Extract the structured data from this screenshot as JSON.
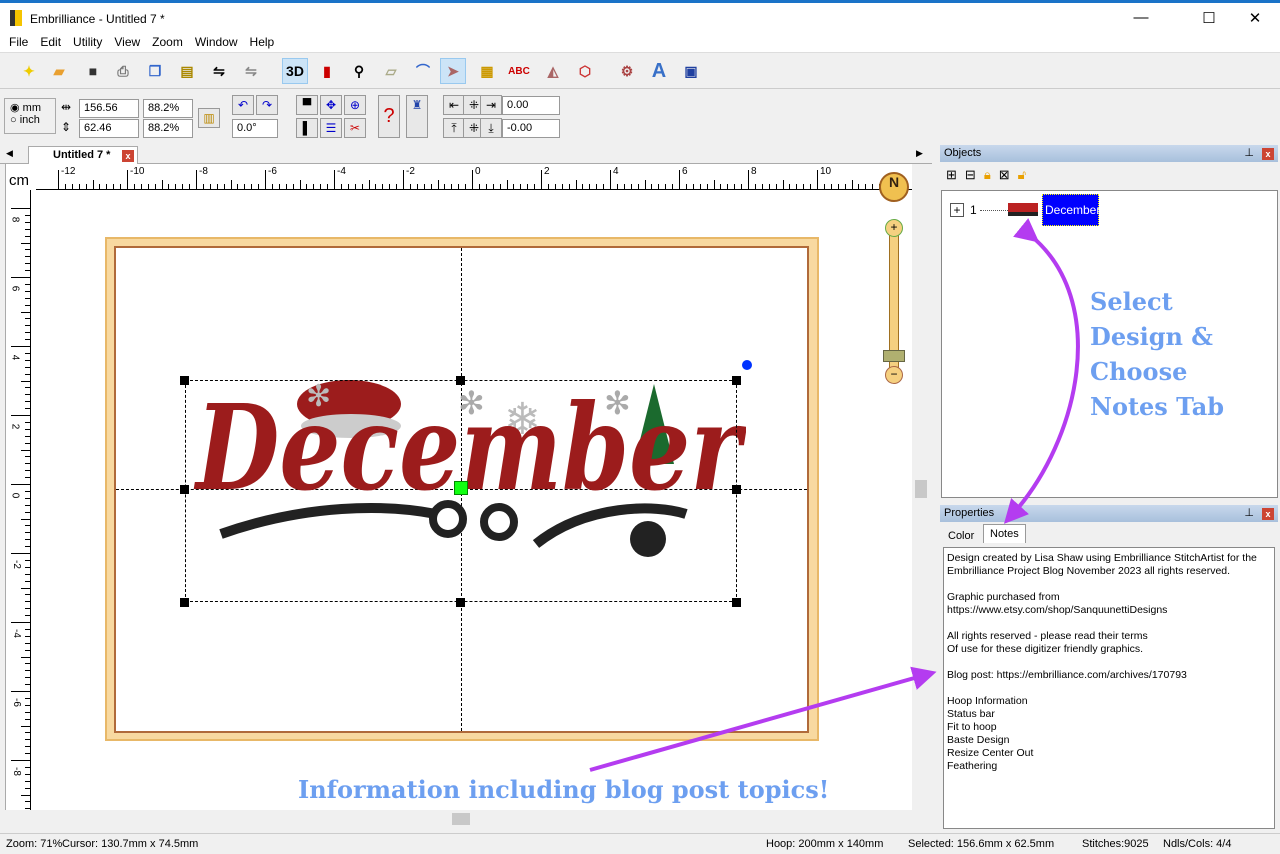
{
  "window": {
    "app": "Embrilliance - ",
    "doc": "Untitled 7 *",
    "minimize": "—",
    "maximize": "☐",
    "close": "✕"
  },
  "menu": [
    "File",
    "Edit",
    "Utility",
    "View",
    "Zoom",
    "Window",
    "Help"
  ],
  "toolbar": {
    "three_d": "3D"
  },
  "size": {
    "unit_mm": "mm",
    "unit_inch": "inch",
    "width": "156.56",
    "width_pct": "88.2%",
    "height": "62.46",
    "height_pct": "88.2%",
    "rotation": "0.0°",
    "offset_x": "0.00",
    "offset_y": "-0.00"
  },
  "tab": {
    "label": "Untitled 7 *"
  },
  "ruler": {
    "unit": "cm",
    "h_labels": [
      "-12",
      "-10",
      "-8",
      "-6",
      "-4",
      "-2",
      "0",
      "2",
      "4",
      "6",
      "8",
      "10"
    ],
    "v_labels": [
      "8",
      "6",
      "4",
      "2",
      "0",
      "-2",
      "-4",
      "-6",
      "-8"
    ]
  },
  "design": {
    "text": "December",
    "compass": "N"
  },
  "objects": {
    "title": "Objects",
    "item_index": "1",
    "item_name": "December"
  },
  "properties": {
    "title": "Properties",
    "tabs": [
      "Color",
      "Notes"
    ],
    "active_tab": "Notes",
    "notes": "Design created by Lisa Shaw using Embrilliance StitchArtist for the Embrilliance Project Blog November 2023 all rights reserved.\n\nGraphic purchased from\nhttps://www.etsy.com/shop/SanquunettiDesigns\n\nAll rights reserved - please read their terms\nOf use for these digitizer friendly graphics.\n\nBlog post: https://embrilliance.com/archives/170793\n\nHoop Information\nStatus bar\nFit to hoop\nBaste Design\nResize Center Out\nFeathering"
  },
  "annotations": {
    "right": "Select\nDesign &\nChoose\nNotes Tab",
    "bottom": "Information including blog post topics!"
  },
  "status": {
    "zoom": "Zoom: 71%",
    "cursor": "Cursor: 130.7mm x 74.5mm",
    "hoop": "Hoop: 200mm x 140mm",
    "selected": "Selected: 156.6mm x 62.5mm",
    "stitches": "Stitches:9025",
    "ndls": "Ndls/Cols: 4/4"
  },
  "colors": {
    "accent": "#0000ff",
    "arrow": "#b43cf0",
    "annotation": "#6d9ff0",
    "design_red": "#9c1c1c"
  }
}
